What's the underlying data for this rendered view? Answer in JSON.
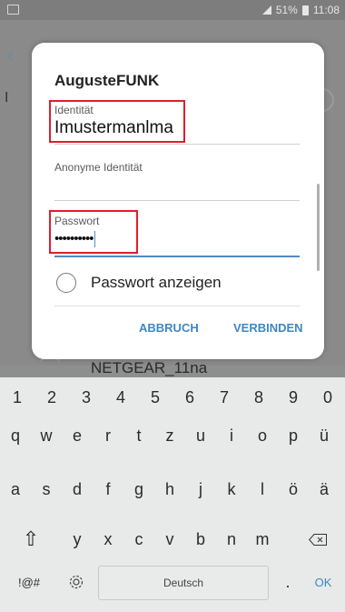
{
  "status": {
    "battery": "51%",
    "time": "11:08"
  },
  "background": {
    "letter": "I",
    "network": "NETGEAR_11na"
  },
  "dialog": {
    "title": "AugusteFUNK",
    "identity": {
      "label": "Identität",
      "value": "Imustermanlma"
    },
    "anon": {
      "label": "Anonyme Identität",
      "value": ""
    },
    "password": {
      "label": "Passwort",
      "value": "••••••••••"
    },
    "show_password_label": "Passwort anzeigen",
    "cancel": "ABBRUCH",
    "connect": "VERBINDEN"
  },
  "keyboard": {
    "row_numbers": [
      "1",
      "2",
      "3",
      "4",
      "5",
      "6",
      "7",
      "8",
      "9",
      "0"
    ],
    "row_q": [
      "q",
      "w",
      "e",
      "r",
      "t",
      "z",
      "u",
      "i",
      "o",
      "p",
      "ü"
    ],
    "row_a": [
      "a",
      "s",
      "d",
      "f",
      "g",
      "h",
      "j",
      "k",
      "l",
      "ö",
      "ä"
    ],
    "row_y": [
      "y",
      "x",
      "c",
      "v",
      "b",
      "n",
      "m"
    ],
    "symbols": "!@#",
    "space": "Deutsch",
    "period": ".",
    "ok": "OK"
  }
}
